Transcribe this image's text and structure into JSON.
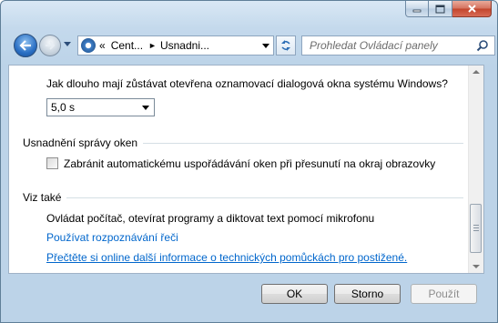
{
  "window": {
    "controls": {
      "minimize": "minimize",
      "maximize": "maximize",
      "close": "close"
    }
  },
  "nav": {
    "address_segments": [
      "Cent...",
      "Usnadni..."
    ],
    "address_prefix": "«",
    "search_placeholder": "Prohledat Ovládací panely"
  },
  "content": {
    "notification_question": "Jak dlouho mají zůstávat otevřena oznamovací dialogová okna systému Windows?",
    "duration_select_value": "5,0 s",
    "window_management_heading": "Usnadnění správy oken",
    "snap_checkbox_label": "Zabránit automatickému uspořádávání oken při přesunutí na okraj obrazovky",
    "snap_checkbox_checked": false,
    "see_also_heading": "Viz také",
    "see_also_description": "Ovládat počítač, otevírat programy a diktovat text pomocí mikrofonu",
    "link_speech": "Používat rozpoznávání řeči",
    "link_online_info": "Přečtěte si online další informace o technických pomůckách pro postižené."
  },
  "buttons": {
    "ok": "OK",
    "cancel": "Storno",
    "apply": "Použít"
  },
  "colors": {
    "link": "#0066cc",
    "chrome": "#bcd3e8"
  }
}
